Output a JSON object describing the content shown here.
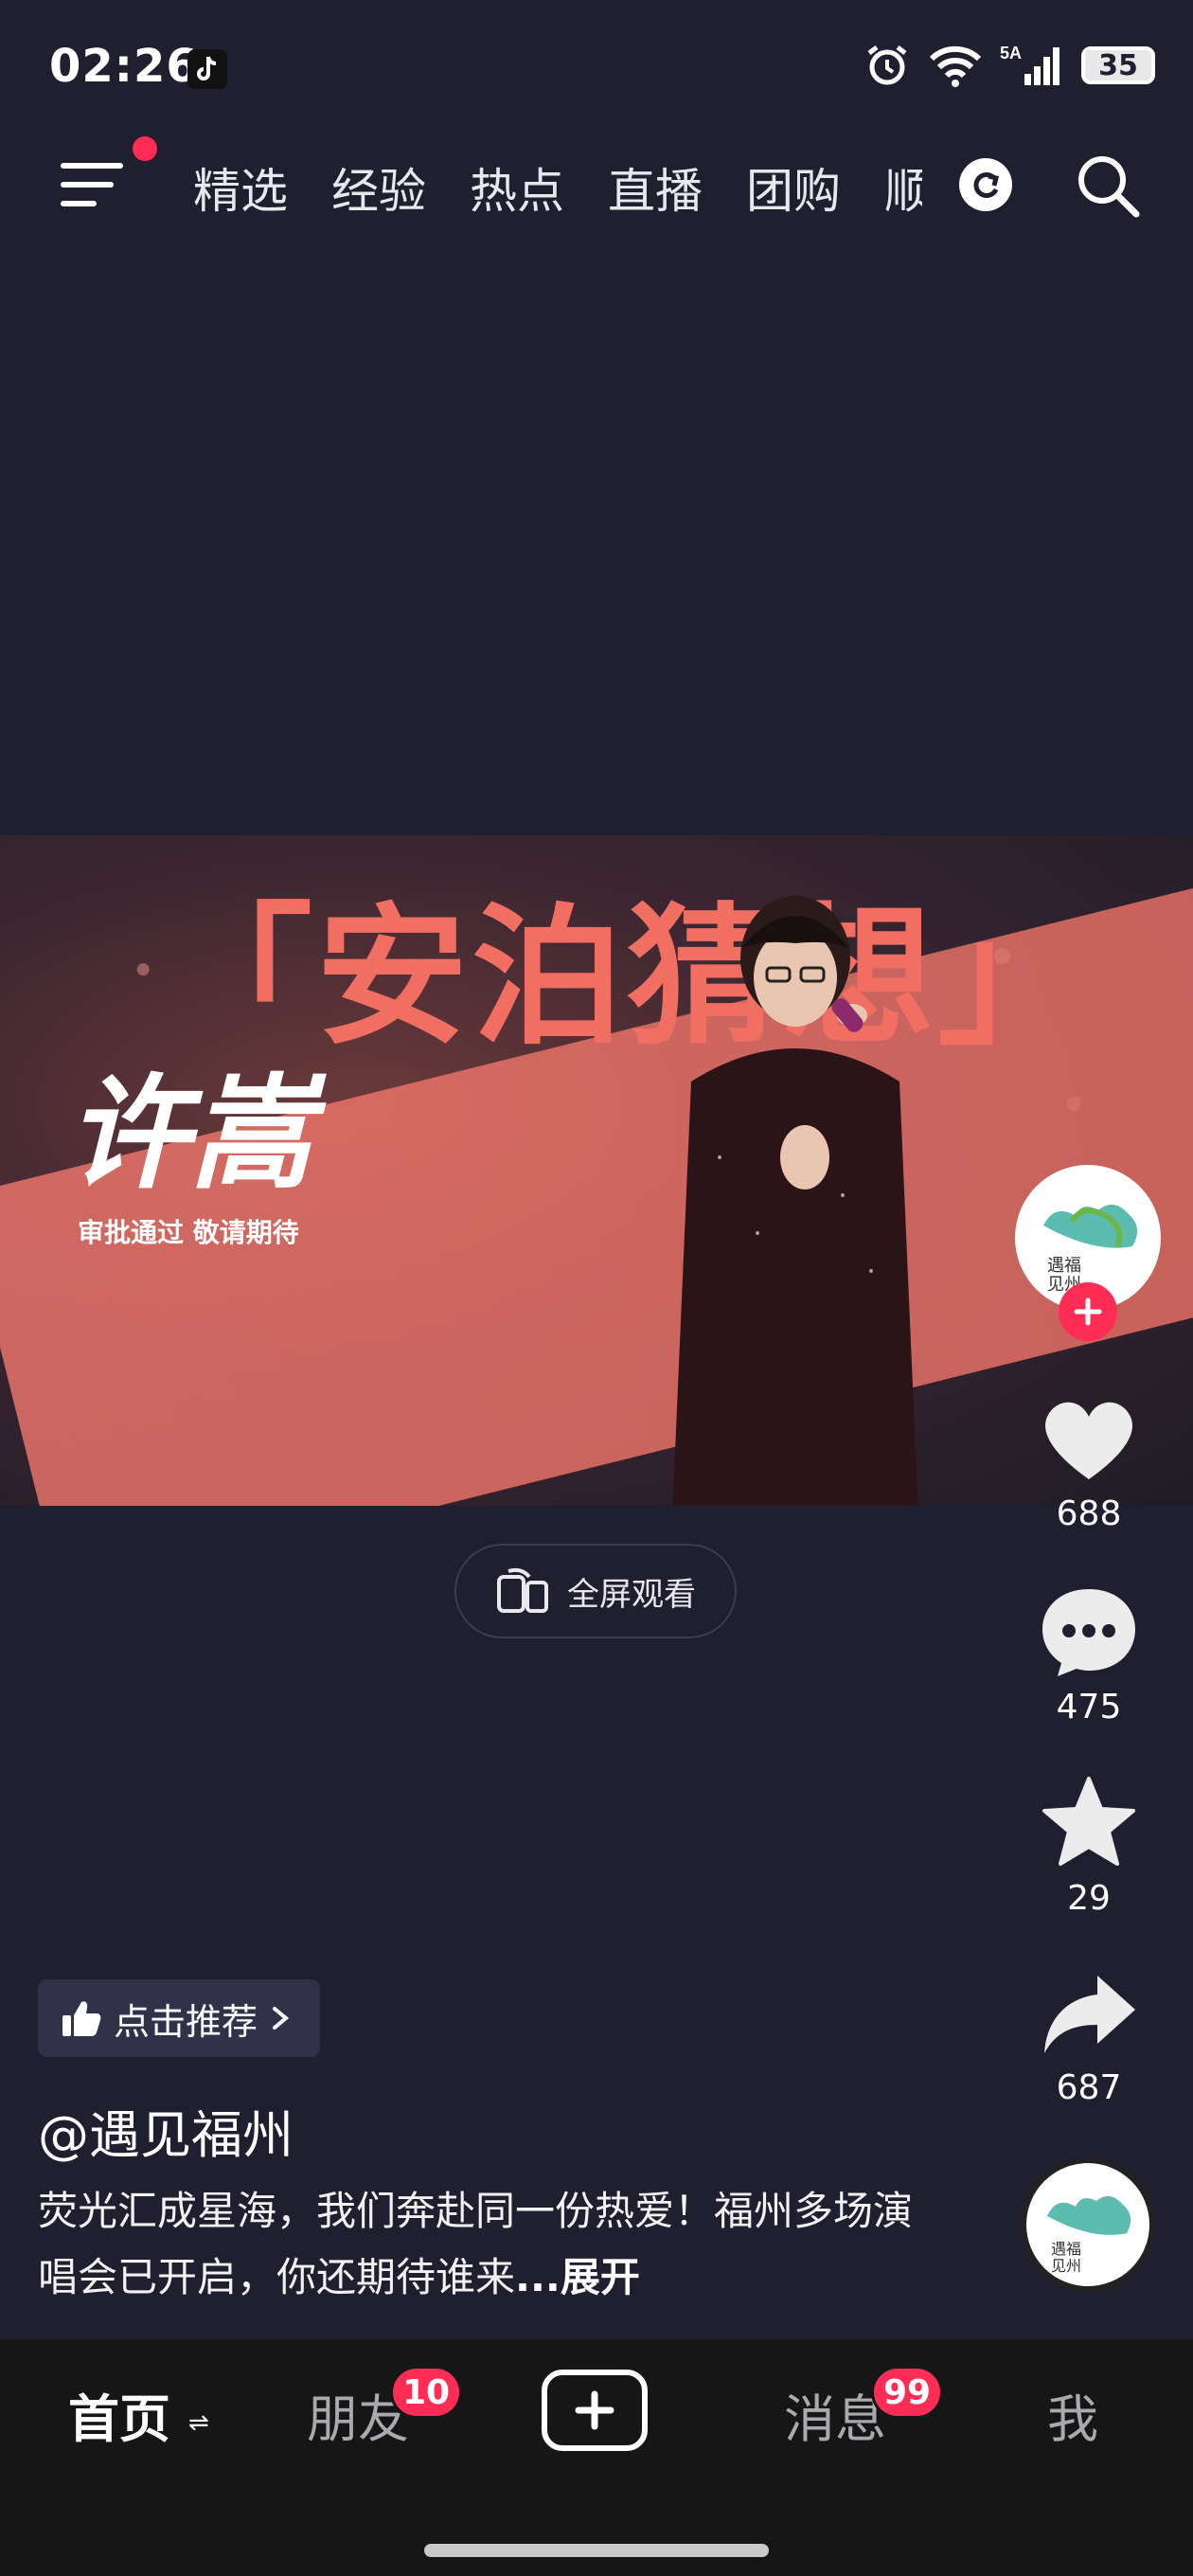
{
  "status_bar": {
    "time": "02:26",
    "network_5g": "5A",
    "signal_6": "6",
    "battery": "35"
  },
  "top_nav": {
    "tabs": [
      "精选",
      "经验",
      "热点",
      "直播",
      "团购",
      "顺"
    ],
    "menu_has_notification": true
  },
  "video": {
    "title": "「安泊猜想」",
    "artist": "许嵩",
    "caption": "审批通过 敬请期待"
  },
  "fullscreen_label": "全屏观看",
  "rail": {
    "likes": "688",
    "comments": "475",
    "favorites": "29",
    "shares": "687"
  },
  "post": {
    "recommend_label": "点击推荐",
    "author": "@遇见福州",
    "description": "荧光汇成星海，我们奔赴同一份热爱！福州多场演唱会已开启，你还期待谁来",
    "ellipsis": "...",
    "expand_label": "展开"
  },
  "bottom_nav": {
    "home": "首页",
    "home_toggle": "⇌",
    "friends": "朋友",
    "friends_badge": "10",
    "messages": "消息",
    "messages_badge": "99",
    "me": "我"
  },
  "colors": {
    "accent": "#ff2c55",
    "background": "#1f1f2f",
    "band": "#f06e62"
  }
}
